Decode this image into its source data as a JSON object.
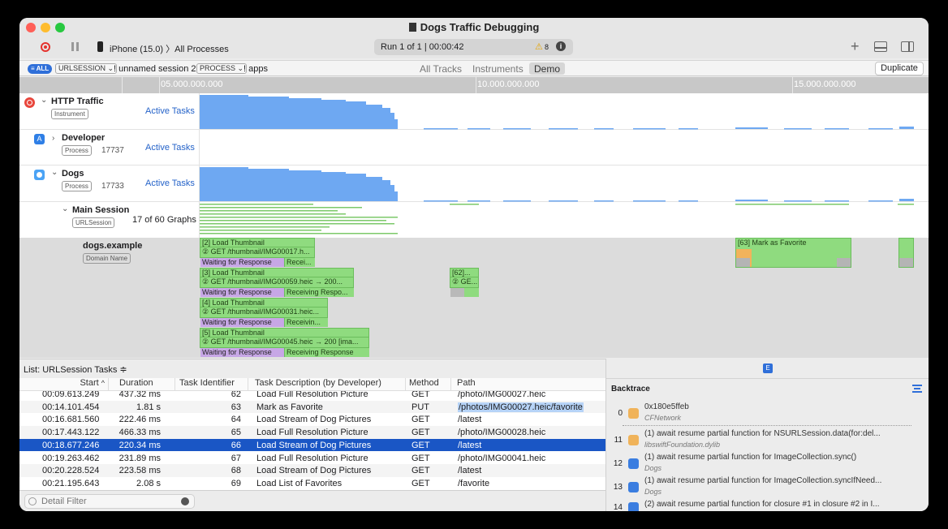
{
  "window": {
    "title": "Dogs Traffic Debugging"
  },
  "toolbar": {
    "device": "iPhone (15.0)",
    "target": "All Processes",
    "run": "Run 1 of 1  |  00:00:42",
    "warning_count": "8",
    "plus": "+"
  },
  "filter": {
    "all": "ALL",
    "chip_urlsession": "URLSESSION ⌄",
    "urlsession_value": "! unnamed session 2",
    "chip_process": "PROCESS ⌄",
    "process_value": "! apps",
    "tabs": [
      "All Tracks",
      "Instruments",
      "Demo"
    ],
    "duplicate": "Duplicate"
  },
  "ruler": [
    "05.000.000.000",
    "10.000.000.000",
    "15.000.000.000"
  ],
  "tracks": [
    {
      "name": "HTTP Traffic",
      "tag": "Instrument",
      "pid": "",
      "value": "Active Tasks"
    },
    {
      "name": "Developer",
      "tag": "Process",
      "pid": "17737",
      "value": "Active Tasks"
    },
    {
      "name": "Dogs",
      "tag": "Process",
      "pid": "17733",
      "value": "Active Tasks"
    },
    {
      "name": "Main Session",
      "tag": "URLSession",
      "pid": "",
      "value": "17 of 60 Graphs"
    }
  ],
  "domain": {
    "name": "dogs.example",
    "tag": "Domain Name",
    "blocks": [
      {
        "title": "[2] Load Thumbnail",
        "req": "② GET /thumbnail/IMG00017.h...",
        "wait": "Waiting for Response",
        "recv": "Recei..."
      },
      {
        "title": "[3] Load Thumbnail",
        "req": "② GET /thumbnail/IMG00059.heic → 200...",
        "wait": "Waiting for Response",
        "recv": "Receiving Respo..."
      },
      {
        "title": "[4] Load Thumbnail",
        "req": "② GET /thumbnail/IMG00031.heic...",
        "wait": "Waiting for Response",
        "recv": "Receivin..."
      },
      {
        "title": "[5] Load Thumbnail",
        "req": "② GET /thumbnail/IMG00045.heic → 200 [ima...",
        "wait": "Waiting for Response",
        "recv": "Receiving Response"
      },
      {
        "title": "[62]...",
        "req": "② GE..."
      },
      {
        "title": "[63] Mark as Favorite"
      }
    ]
  },
  "list": {
    "title": "List: URLSession Tasks ≑",
    "columns": [
      "Start",
      "Duration",
      "Task Identifier",
      "Task Description (by Developer)",
      "Method",
      "Path"
    ],
    "rows": [
      {
        "start": "00:09.613.249",
        "duration": "437.32 ms",
        "id": "62",
        "desc": "Load Full Resolution Picture",
        "method": "GET",
        "path": "/photo/IMG00027.heic"
      },
      {
        "start": "00:14.101.454",
        "duration": "1.81 s",
        "id": "63",
        "desc": "Mark as Favorite",
        "method": "PUT",
        "path": "/photos/IMG00027.heic/favorite"
      },
      {
        "start": "00:16.681.560",
        "duration": "222.46 ms",
        "id": "64",
        "desc": "Load Stream of Dog Pictures",
        "method": "GET",
        "path": "/latest"
      },
      {
        "start": "00:17.443.122",
        "duration": "466.33 ms",
        "id": "65",
        "desc": "Load Full Resolution Picture",
        "method": "GET",
        "path": "/photo/IMG00028.heic"
      },
      {
        "start": "00:18.677.246",
        "duration": "220.34 ms",
        "id": "66",
        "desc": "Load Stream of Dog Pictures",
        "method": "GET",
        "path": "/latest"
      },
      {
        "start": "00:19.263.462",
        "duration": "231.89 ms",
        "id": "67",
        "desc": "Load Full Resolution Picture",
        "method": "GET",
        "path": "/photo/IMG00041.heic"
      },
      {
        "start": "00:20.228.524",
        "duration": "223.58 ms",
        "id": "68",
        "desc": "Load Stream of Dog Pictures",
        "method": "GET",
        "path": "/latest"
      },
      {
        "start": "00:21.195.643",
        "duration": "2.08 s",
        "id": "69",
        "desc": "Load List of Favorites",
        "method": "GET",
        "path": "/favorite"
      }
    ],
    "detail_placeholder": "Detail Filter"
  },
  "backtrace": {
    "header": "Backtrace",
    "frames": [
      {
        "num": "0",
        "main": "0x180e5ffeb",
        "sub": "CFNetwork"
      },
      {
        "num": "11",
        "main": "(1) await resume partial function for NSURLSession.data(for:del...",
        "sub": "libswiftFoundation.dylib"
      },
      {
        "num": "12",
        "main": "(1) await resume partial function for ImageCollection.sync()",
        "sub": "Dogs"
      },
      {
        "num": "13",
        "main": "(1) await resume partial function for ImageCollection.syncIfNeed...",
        "sub": "Dogs"
      },
      {
        "num": "14",
        "main": "(2) await resume partial function for closure #1 in closure #2 in I...",
        "sub": ""
      }
    ]
  }
}
